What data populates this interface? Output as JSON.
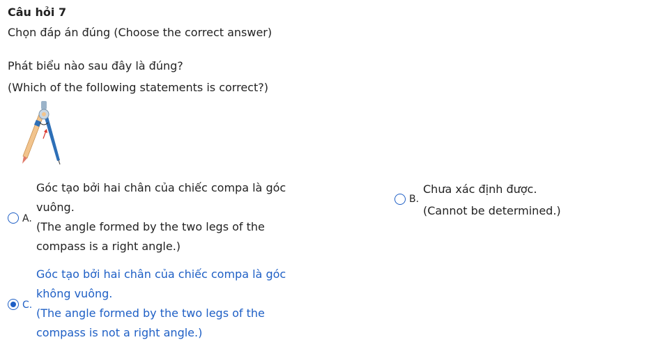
{
  "question": {
    "title": "Câu hỏi 7",
    "instruction": "Chọn đáp án đúng (Choose the correct answer)",
    "text_vi": "Phát biểu nào sau đây là đúng?",
    "text_en": "(Which of the following statements is correct?)"
  },
  "image": {
    "icon": "compass-icon"
  },
  "options": {
    "a": {
      "letter": "A.",
      "line1": "Góc tạo bởi hai chân của chiếc compa là góc",
      "line2": "vuông.",
      "line3": "(The angle formed by the two legs of the",
      "line4": "compass is a right angle.)",
      "selected": false
    },
    "b": {
      "letter": "B.",
      "line1": "Chưa xác định được.",
      "line2": "(Cannot be determined.)",
      "selected": false
    },
    "c": {
      "letter": "C.",
      "line1": "Góc tạo bởi hai chân của chiếc compa là góc",
      "line2": "không vuông.",
      "line3": "(The angle formed by the two legs of the",
      "line4": "compass is not a right angle.)",
      "selected": true
    }
  },
  "colors": {
    "accent": "#1e5fc5",
    "text": "#222222"
  }
}
